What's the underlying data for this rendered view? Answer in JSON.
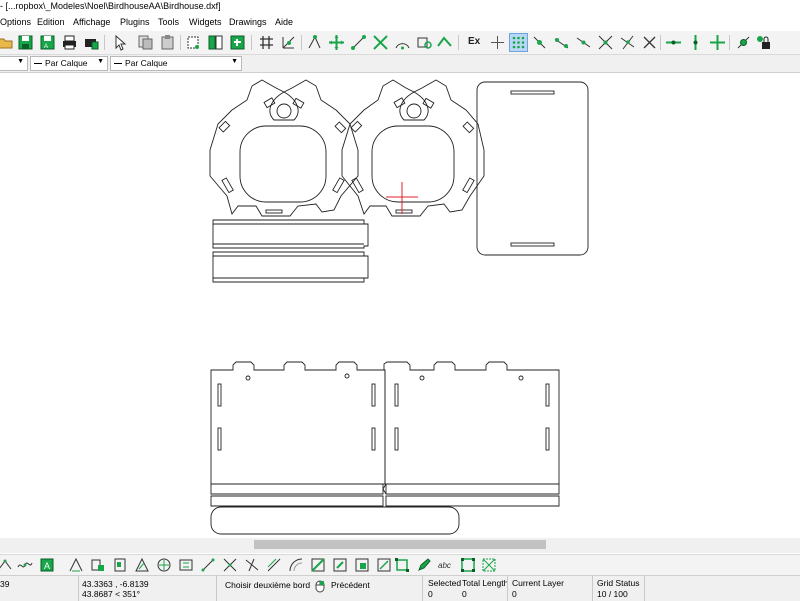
{
  "window": {
    "title": "- [...ropbox\\_Modeles\\Noel\\BirdhouseAA\\Birdhouse.dxf]"
  },
  "menu": {
    "items": [
      {
        "label": "Options"
      },
      {
        "label": "Edition"
      },
      {
        "label": "Affichage"
      },
      {
        "label": "Plugins"
      },
      {
        "label": "Tools"
      },
      {
        "label": "Widgets"
      },
      {
        "label": "Drawings"
      },
      {
        "label": "Aide"
      }
    ]
  },
  "toolbar": {
    "ex_label": "Ex",
    "icons": [
      "open-icon",
      "save-icon",
      "save-as-icon",
      "print-icon",
      "print-preview-icon",
      "pointer-icon",
      "copy-icon",
      "paste-icon",
      "cut-icon",
      "block-icon",
      "block-insert-icon",
      "grid-icon",
      "snap-icon",
      "snap-free-icon",
      "snap-grid-icon",
      "snap-endpoint-icon",
      "snap-entity-icon",
      "snap-center-icon",
      "snap-middle-icon",
      "snap-distance-icon",
      "snap-intersection-icon"
    ]
  },
  "layer_bar": {
    "combo_left": "",
    "combo_linetype": "Par Calque",
    "combo_width": "Par Calque"
  },
  "status": {
    "left_value": "39",
    "coord_abs": "43.3363 , -6.8139",
    "coord_polar": "43.8687 < 351°",
    "prompt_label": "Choisir deuxième bord",
    "prompt_previous": "Précédent",
    "selected_label": "Selected",
    "selected_value": "0",
    "total_length_label": "Total Length",
    "total_length_value": "0",
    "current_layer_label": "Current Layer",
    "current_layer_value": "0",
    "grid_status_label": "Grid Status",
    "grid_status_value": "10 / 100"
  },
  "colors": {
    "accent_green": "#19a64a",
    "crosshair_red": "#e0202a",
    "toolbar_bg": "#f3f3f3",
    "canvas_bg": "#ffffff"
  }
}
